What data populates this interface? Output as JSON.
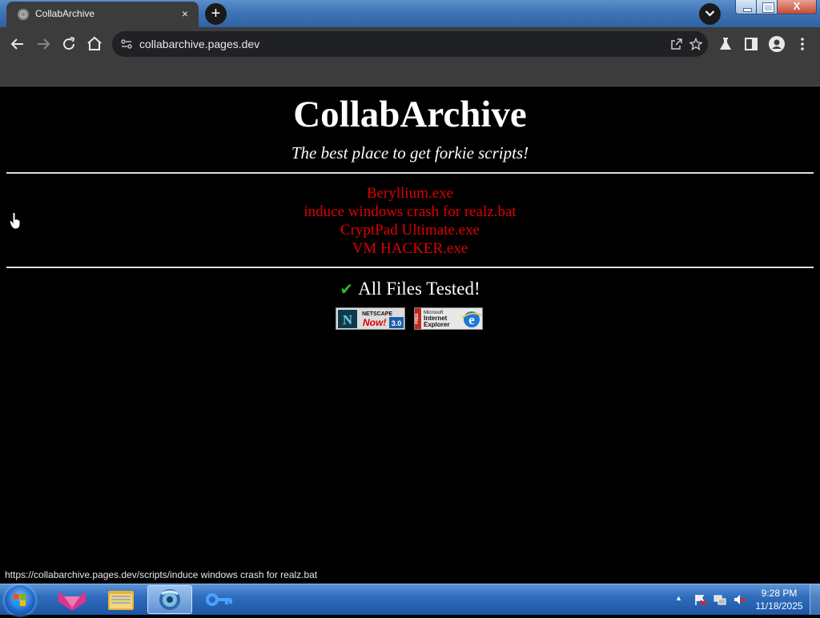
{
  "browser": {
    "tab_title": "CollabArchive",
    "tab_close": "×",
    "new_tab": "+",
    "url": "collabarchive.pages.dev",
    "status_url": "https://collabarchive.pages.dev/scripts/induce windows crash for realz.bat"
  },
  "window": {
    "close_glyph": "X"
  },
  "page": {
    "title": "CollabArchive",
    "tagline": "The best place to get forkie scripts!",
    "files": [
      "Beryllium.exe",
      "induce windows crash for realz.bat",
      "CryptPad Ultimate.exe",
      "VM HACKER.exe"
    ],
    "tested_check": "✔",
    "tested_text": "All Files Tested!",
    "badge_netscape": {
      "brand": "NETSCAPE",
      "slogan": "Now!",
      "version": "3.0",
      "logo_letter": "N"
    },
    "badge_ie": {
      "side": "FREE",
      "line1": "Microsoft",
      "line2": "Internet",
      "line3": "Explorer"
    }
  },
  "taskbar": {
    "time": "9:28 PM",
    "date": "11/18/2025",
    "tray_arrow": "▲"
  },
  "colors": {
    "link_red": "#e00000",
    "check_green": "#2eb82e",
    "chrome_dark": "#3c3c3c",
    "omnibox": "#202124"
  }
}
